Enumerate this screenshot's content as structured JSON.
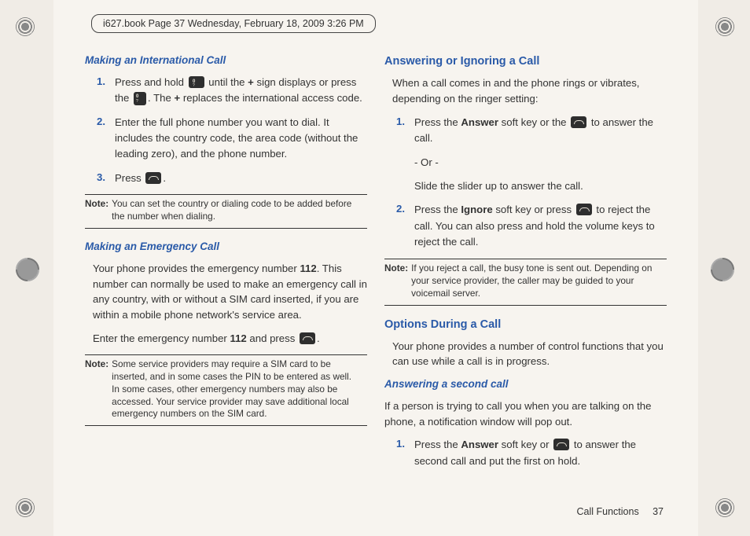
{
  "header": "i627.book  Page 37  Wednesday, February 18, 2009  3:26 PM",
  "left": {
    "h1": "Making an International Call",
    "s1a": "Press and hold ",
    "s1b": " until the ",
    "plus1": "+",
    "s1c": " sign displays or press the ",
    "s1d": ". The ",
    "plus2": "+",
    "s1e": " replaces the international access code.",
    "s1full_dummy": "",
    "s2": "Enter the full phone number you want to dial. It includes the country code, the area code (without the leading zero), and the phone number.",
    "s3a": "Press ",
    "s3b": ".",
    "note1lbl": "Note:",
    "note1": "You can set the country or dialing code to be added before the number when dialing.",
    "h2": "Making an Emergency Call",
    "p1a": "Your phone provides the emergency number ",
    "p1num": "112",
    "p1b": ". This number can normally be used to make an emergency call in any country, with or without a SIM card inserted, if you are within a mobile phone network's service area.",
    "p2a": "Enter the emergency number ",
    "p2num": "112",
    "p2b": " and press ",
    "p2c": ".",
    "note2lbl": "Note:",
    "note2": "Some service providers may require a SIM card to be inserted, and in some cases the PIN to be entered as well.\nIn some cases, other emergency numbers may also be accessed. Your service provider may save additional local emergency numbers on the SIM card."
  },
  "right": {
    "h1": "Answering or Ignoring a Call",
    "p1": "When a call comes in and the phone rings or vibrates, depending on the ringer setting:",
    "s1a": "Press the ",
    "s1ans": "Answer",
    "s1b": " soft key or the ",
    "s1c": " to answer the call.",
    "or": "- Or -",
    "slide": "Slide the slider up to answer the call.",
    "s2a": "Press the ",
    "s2ign": "Ignore",
    "s2b": " soft key or press ",
    "s2c": " to reject the call. You can also press and hold the volume keys to reject the call.",
    "note1lbl": "Note:",
    "note1": "If you reject a call, the busy tone is sent out. Depending on your service provider, the caller may be guided to your voicemail server.",
    "h2": "Options During a Call",
    "p2": "Your phone provides a number of control functions that you can use while a call is in progress.",
    "h3": "Answering a second call",
    "p3": "If a person is trying to call you when you are talking on the phone, a notification window will pop out.",
    "s3a": "Press the ",
    "s3ans": "Answer",
    "s3b": " soft key or ",
    "s3c": " to answer the second call and put the first on hold."
  },
  "footer_label": "Call Functions",
  "footer_page": "37",
  "nums": {
    "n1": "1.",
    "n2": "2.",
    "n3": "3."
  }
}
